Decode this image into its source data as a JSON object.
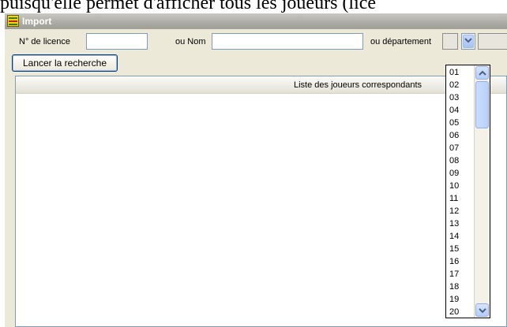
{
  "document": {
    "text_fragment": "puisqu'elle permet d'afficher tous les joueurs (lice"
  },
  "window": {
    "title": "Import"
  },
  "search": {
    "licence_label": "N° de licence",
    "licence_value": "",
    "name_label": "ou Nom",
    "name_value": "",
    "department_label": "ou département",
    "department_value": "",
    "search_button": "Lancer la recherche"
  },
  "results": {
    "column_header": "Liste des joueurs correspondants"
  },
  "department_dropdown": {
    "options": [
      "01",
      "02",
      "03",
      "04",
      "05",
      "06",
      "07",
      "08",
      "09",
      "10",
      "11",
      "12",
      "13",
      "14",
      "15",
      "16",
      "17",
      "18",
      "19",
      "20"
    ]
  },
  "colors": {
    "titlebar": "#aeada6",
    "window_background": "#ece9d8",
    "input_border": "#7f9db9",
    "scrollbar_blue": "#b5ccf6"
  },
  "icons": {
    "app": "app-logo-icon",
    "dropdown_arrow": "chevron-down-icon",
    "scroll_up": "chevron-up-icon",
    "scroll_down": "chevron-down-icon"
  }
}
